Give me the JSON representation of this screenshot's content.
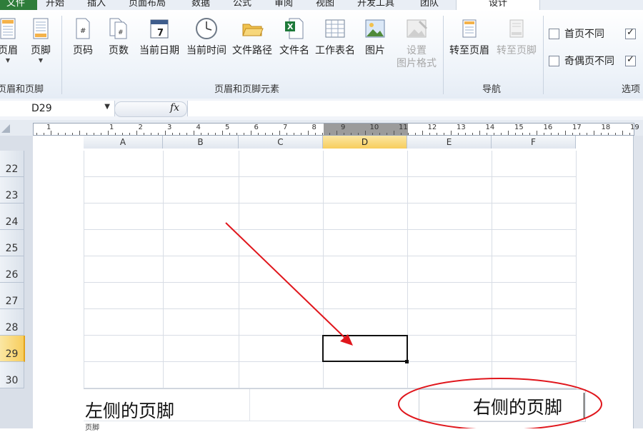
{
  "ribbon_tabs": [
    "文件",
    "开始",
    "插入",
    "页面布局",
    "数据",
    "公式",
    "审阅",
    "视图",
    "开发工具",
    "团队",
    "设计"
  ],
  "active_tab": "设计",
  "file_tab_color": "#2e7d3a",
  "groups": {
    "header_footer": {
      "label": "页眉和页脚",
      "buttons": [
        {
          "label": "页眉",
          "icon": "header-page-icon"
        },
        {
          "label": "页脚",
          "icon": "footer-page-icon"
        }
      ]
    },
    "elements": {
      "label": "页眉和页脚元素",
      "buttons": [
        {
          "label": "页码",
          "icon": "page-number-icon"
        },
        {
          "label": "页数",
          "icon": "page-count-icon"
        },
        {
          "label": "当前日期",
          "icon": "calendar-icon"
        },
        {
          "label": "当前时间",
          "icon": "clock-icon"
        },
        {
          "label": "文件路径",
          "icon": "folder-icon"
        },
        {
          "label": "文件名",
          "icon": "excel-file-icon"
        },
        {
          "label": "工作表名",
          "icon": "sheet-icon"
        },
        {
          "label": "图片",
          "icon": "picture-icon"
        },
        {
          "label": "设置",
          "label2": "图片格式",
          "icon": "format-picture-icon",
          "disabled": true
        }
      ]
    },
    "navigation": {
      "label": "导航",
      "buttons": [
        {
          "label": "转至页眉",
          "icon": "goto-header-icon"
        },
        {
          "label": "转至页脚",
          "icon": "goto-footer-icon",
          "disabled": true
        }
      ]
    },
    "options": {
      "label": "选项",
      "checkboxes": [
        {
          "label": "首页不同",
          "checked": false
        },
        {
          "label": "奇偶页不同",
          "checked": false
        }
      ],
      "partial_checked": [
        true,
        true
      ]
    }
  },
  "formula_bar": {
    "name_box": "D29",
    "fx": "fx",
    "formula": ""
  },
  "ruler_numbers": [
    "1",
    "1",
    "2",
    "3",
    "4",
    "5",
    "6",
    "7",
    "8",
    "9",
    "10",
    "11",
    "12",
    "13",
    "14",
    "15",
    "16",
    "17",
    "18",
    "19"
  ],
  "columns": [
    "A",
    "B",
    "C",
    "D",
    "E",
    "F"
  ],
  "selected_column": "D",
  "rows": [
    "22",
    "23",
    "24",
    "25",
    "26",
    "27",
    "28",
    "29",
    "30"
  ],
  "selected_row": "29",
  "footer": {
    "left_text": "左侧的页脚",
    "right_text": "右侧的页脚",
    "caption": "页脚"
  },
  "colors": {
    "annotation_red": "#e0161c",
    "selection_highlight": "#f7cd5d"
  }
}
